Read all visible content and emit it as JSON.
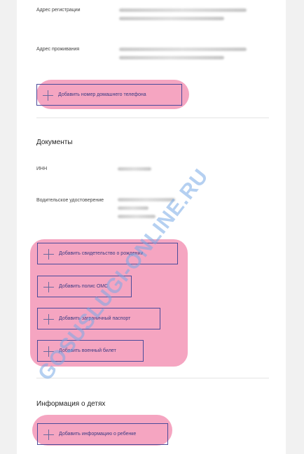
{
  "fields": {
    "registration_label": "Адрес регистрации",
    "residence_label": "Адрес проживания",
    "inn_label": "ИНН",
    "license_label": "Водительское удостоверение"
  },
  "buttons": {
    "add_home_phone": "Добавить номер домашнего телефона",
    "add_birth_certificate": "Добавить свидетельство о рождении",
    "add_oms_policy": "Добавить полис ОМС",
    "add_foreign_passport": "Добавить заграничный паспорт",
    "add_military_id": "Добавить военный билет",
    "add_child_info": "Добавить информацию о ребенке"
  },
  "sections": {
    "documents_title": "Документы",
    "children_title": "Информация о детях"
  },
  "watermark": "GOSUSLUGI-ONLINE.RU",
  "colors": {
    "highlight": "#f4a0be",
    "button_border": "#4b4b9a",
    "watermark": "#78aae6"
  },
  "icons": {
    "add": "plus-icon"
  }
}
